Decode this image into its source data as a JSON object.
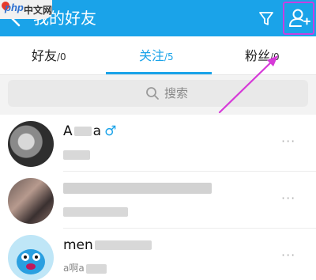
{
  "header": {
    "title": "我的好友",
    "back_icon": "chevron-left-icon",
    "filter_icon": "filter-icon",
    "add_user_icon": "add-user-icon",
    "logo": {
      "php": "php",
      "cn": "中文网"
    }
  },
  "tabs": [
    {
      "label": "好友",
      "count": "/0"
    },
    {
      "label": "关注",
      "count": "/5",
      "active": true
    },
    {
      "label": "粉丝",
      "count": "/0"
    }
  ],
  "search": {
    "placeholder": "搜索"
  },
  "contacts": [
    {
      "name": "A",
      "name_suffix": "a",
      "gender": "♂",
      "sub": "",
      "more": "···"
    },
    {
      "name": "",
      "gender": "",
      "sub": "",
      "more": "···"
    },
    {
      "name": "men",
      "gender": "",
      "sub": "a啊a",
      "more": "···"
    }
  ],
  "colors": {
    "accent": "#1aa3e9",
    "annotation": "#c83fe0"
  }
}
